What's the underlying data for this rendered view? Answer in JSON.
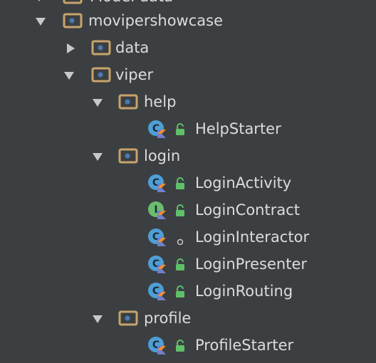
{
  "tree": {
    "top_cut_label": "Model data",
    "nodes": [
      {
        "label": "movipershowcase",
        "kind": "package",
        "expanded": true
      },
      {
        "label": "data",
        "kind": "package",
        "expanded": false
      },
      {
        "label": "viper",
        "kind": "package",
        "expanded": true
      },
      {
        "label": "help",
        "kind": "package",
        "expanded": true
      },
      {
        "label": "HelpStarter",
        "kind": "kotlin-class",
        "visibility": "public"
      },
      {
        "label": "login",
        "kind": "package",
        "expanded": true
      },
      {
        "label": "LoginActivity",
        "kind": "kotlin-class",
        "visibility": "public"
      },
      {
        "label": "LoginContract",
        "kind": "kotlin-interface",
        "visibility": "public"
      },
      {
        "label": "LoginInteractor",
        "kind": "kotlin-class",
        "visibility": "internal"
      },
      {
        "label": "LoginPresenter",
        "kind": "kotlin-class",
        "visibility": "public"
      },
      {
        "label": "LoginRouting",
        "kind": "kotlin-class",
        "visibility": "public"
      },
      {
        "label": "profile",
        "kind": "package",
        "expanded": true
      },
      {
        "label": "ProfileStarter",
        "kind": "kotlin-class",
        "visibility": "public"
      }
    ]
  },
  "colors": {
    "background": "#3c3f41",
    "text": "#dcdcdc",
    "arrow": "#c8c8c8",
    "folder": "#c7a46b",
    "package_dot": "#4a7ab5",
    "class_badge": "#4e9fd6",
    "interface_badge": "#6cbd70",
    "lock": "#5fbf6a",
    "kotlin_orange": "#f28d32",
    "kotlin_blue": "#5b7ee8"
  }
}
